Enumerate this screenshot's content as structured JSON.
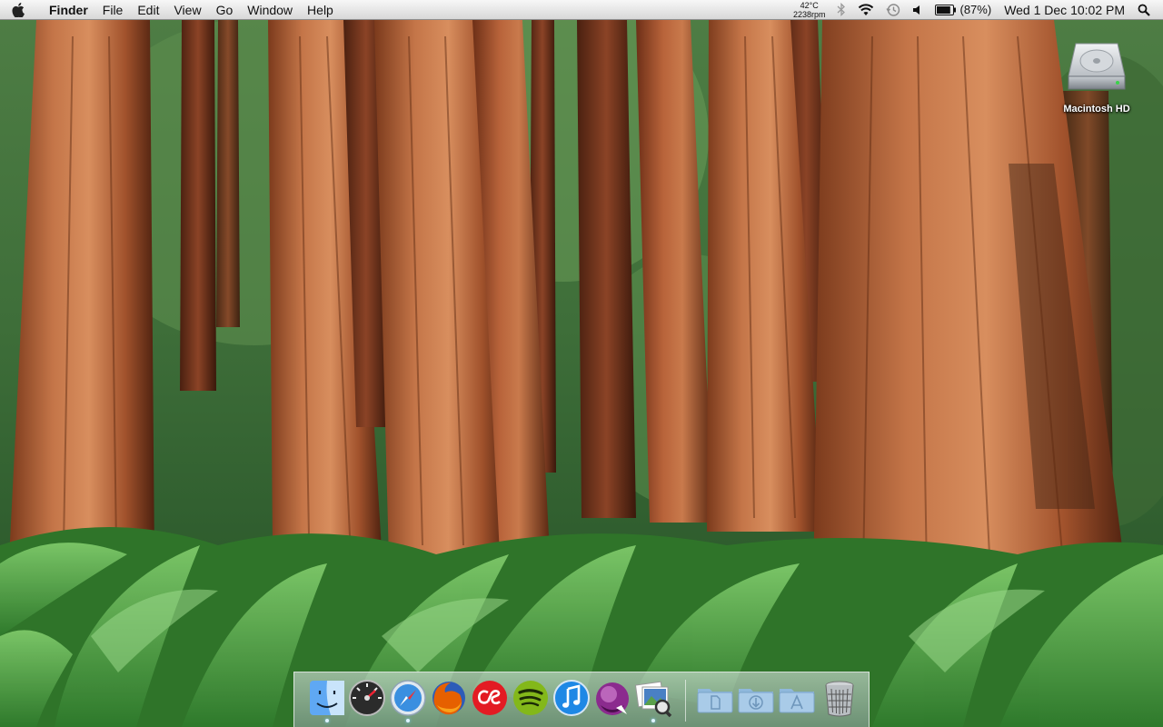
{
  "menubar": {
    "app_name": "Finder",
    "menus": [
      "File",
      "Edit",
      "View",
      "Go",
      "Window",
      "Help"
    ],
    "temperature": "42°C",
    "fan_speed": "2238rpm",
    "battery_percent": "(87%)",
    "battery_level": 0.87,
    "datetime": "Wed 1 Dec  10:02 PM"
  },
  "desktop": {
    "icons": [
      {
        "label": "Macintosh HD",
        "icon": "hard-drive-icon"
      }
    ]
  },
  "dock": {
    "apps": [
      {
        "name": "finder",
        "icon": "finder-icon",
        "running": true
      },
      {
        "name": "dashboard",
        "icon": "dashboard-icon",
        "running": false
      },
      {
        "name": "safari",
        "icon": "safari-icon",
        "running": true
      },
      {
        "name": "firefox",
        "icon": "firefox-icon",
        "running": false
      },
      {
        "name": "lastfm",
        "icon": "lastfm-icon",
        "running": false
      },
      {
        "name": "spotify",
        "icon": "spotify-icon",
        "running": false
      },
      {
        "name": "itunes",
        "icon": "itunes-icon",
        "running": false
      },
      {
        "name": "growl",
        "icon": "growl-icon",
        "running": false
      },
      {
        "name": "preview",
        "icon": "preview-icon",
        "running": true
      }
    ],
    "stacks": [
      {
        "name": "documents",
        "icon": "documents-folder-icon"
      },
      {
        "name": "downloads",
        "icon": "downloads-folder-icon"
      },
      {
        "name": "applications",
        "icon": "applications-folder-icon"
      },
      {
        "name": "trash",
        "icon": "trash-icon"
      }
    ]
  },
  "colors": {
    "menubar_bg": "#e8e8e8",
    "spotify_green": "#83b81a",
    "lastfm_red": "#e31b23",
    "firefox_orange": "#e66000",
    "itunes_blue": "#1e88e5"
  }
}
